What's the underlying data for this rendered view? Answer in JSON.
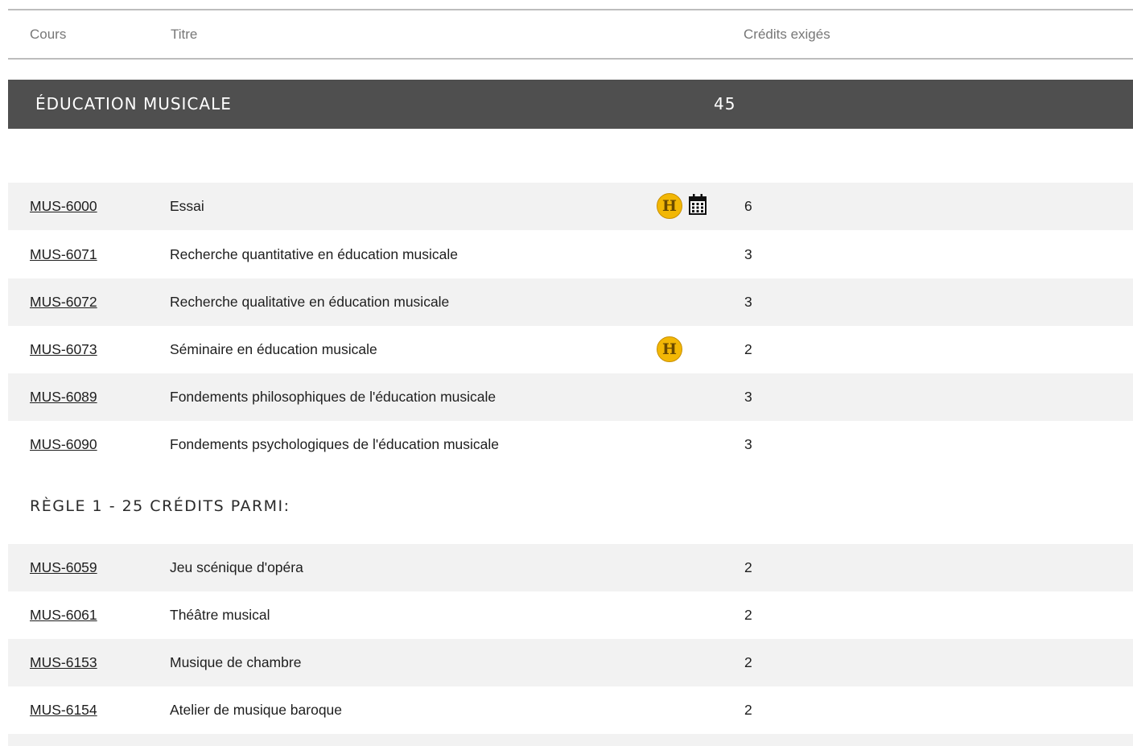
{
  "table_header": {
    "cours": "Cours",
    "titre": "Titre",
    "credits": "Crédits exigés"
  },
  "section": {
    "title": "ÉDUCATION MUSICALE",
    "credits": "45"
  },
  "required_courses": [
    {
      "code": "MUS-6000",
      "title": "Essai",
      "credits": "6",
      "icons": [
        "h-badge-icon",
        "calendar-icon"
      ]
    },
    {
      "code": "MUS-6071",
      "title": "Recherche quantitative en éducation musicale",
      "credits": "3",
      "icons": []
    },
    {
      "code": "MUS-6072",
      "title": "Recherche qualitative en éducation musicale",
      "credits": "3",
      "icons": []
    },
    {
      "code": "MUS-6073",
      "title": "Séminaire en éducation musicale",
      "credits": "2",
      "icons": [
        "h-badge-icon"
      ]
    },
    {
      "code": "MUS-6089",
      "title": "Fondements philosophiques de l'éducation musicale",
      "credits": "3",
      "icons": []
    },
    {
      "code": "MUS-6090",
      "title": "Fondements psychologiques de l'éducation musicale",
      "credits": "3",
      "icons": []
    }
  ],
  "rule": {
    "title": "RÈGLE 1 - 25 CRÉDITS PARMI:"
  },
  "rule_courses": [
    {
      "code": "MUS-6059",
      "title": "Jeu scénique d'opéra",
      "credits": "2"
    },
    {
      "code": "MUS-6061",
      "title": "Théâtre musical",
      "credits": "2"
    },
    {
      "code": "MUS-6153",
      "title": "Musique de chambre",
      "credits": "2"
    },
    {
      "code": "MUS-6154",
      "title": "Atelier de musique baroque",
      "credits": "2"
    }
  ],
  "badge": {
    "letter": "H",
    "color": "#f2b705"
  }
}
